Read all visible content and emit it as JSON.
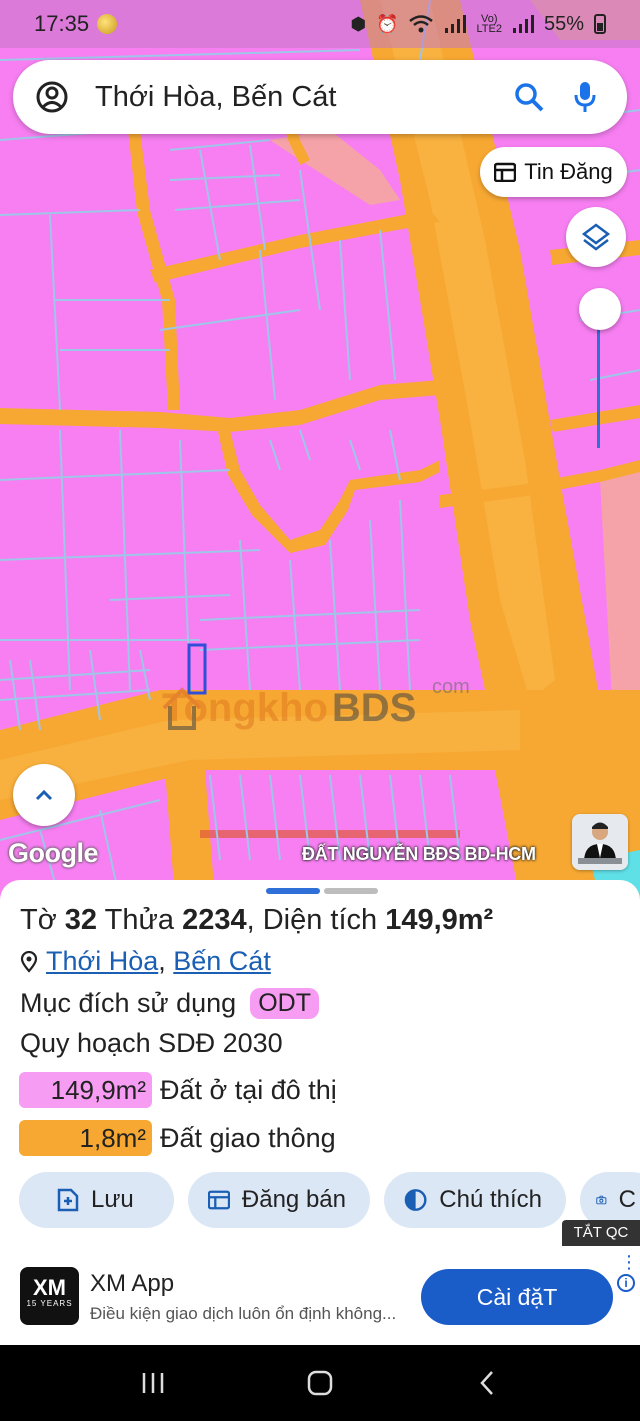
{
  "status_bar": {
    "time": "17:35",
    "battery": "55%"
  },
  "search": {
    "value": "Thới Hòa, Bến Cát"
  },
  "map": {
    "tin_dang_label": "Tin Đăng",
    "google_label": "Google",
    "watermark": {
      "text": "Tongkho",
      "bds": "BDS",
      "com": "com"
    },
    "author_label": "ĐẤT NGUYỄN BĐS BD-HCM",
    "zoom_level": 0.9,
    "colors": {
      "residential": "#f77ff2",
      "road": "#f7a832",
      "commercial": "#f5a3a8",
      "parcel_line": "#9fc5e8",
      "highlight": "#2f6fd8"
    }
  },
  "sheet": {
    "title": {
      "to_label": "Tờ",
      "to_value": "32",
      "thua_label": "Thửa",
      "thua_value": "2234",
      "area_label": ", Diện tích",
      "area_value": "149,9m²"
    },
    "location": {
      "ward": "Thới Hòa",
      "district": "Bến Cát"
    },
    "purpose_label": "Mục đích sử dụng",
    "purpose_code": "ODT",
    "plan_title": "Quy hoạch SDĐ 2030",
    "zones": [
      {
        "area": "149,9m²",
        "label": "Đất ở tại đô thị",
        "color": "#f79cf3"
      },
      {
        "area": "1,8m²",
        "label": "Đất giao thông",
        "color": "#f7a832"
      }
    ],
    "actions": [
      {
        "label": "Lưu",
        "icon": "save-icon"
      },
      {
        "label": "Đăng bán",
        "icon": "calendar-icon"
      },
      {
        "label": "Chú thích",
        "icon": "legend-icon"
      },
      {
        "label": "C",
        "icon": "camera-icon"
      }
    ]
  },
  "ad": {
    "close_label": "TẮT QC",
    "logo_text": "XM",
    "logo_sub": "15 YEARS",
    "title": "XM App",
    "description": "Điều kiện giao dịch luôn ổn định không...",
    "cta": "Cài đặT"
  }
}
